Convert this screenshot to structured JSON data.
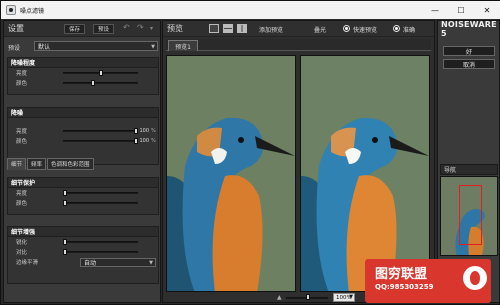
{
  "window": {
    "title": "噪点滤镜",
    "controls": [
      "—",
      "☐",
      "✕"
    ]
  },
  "left": {
    "header": "设置",
    "save": "保存",
    "preset_btn": "预设",
    "preset_label": "预设",
    "preset_value": "默认",
    "sections": [
      {
        "title": "降噪程度",
        "rows": [
          {
            "label": "亮度",
            "pos": 0.5
          },
          {
            "label": "颜色",
            "pos": 0.4
          }
        ]
      },
      {
        "title": "降噪",
        "rows": [
          {
            "label": "亮度",
            "value": "100",
            "unit": "%",
            "pos": 1.0
          },
          {
            "label": "颜色",
            "value": "100",
            "unit": "%",
            "pos": 1.0
          }
        ]
      },
      {
        "title": "细节保护",
        "rows": [
          {
            "label": "亮度",
            "pos": 0.0
          },
          {
            "label": "颜色",
            "pos": 0.0
          }
        ]
      },
      {
        "title": "细节增强",
        "rows": [
          {
            "label": "锐化",
            "pos": 0.0
          },
          {
            "label": "对比",
            "pos": 0.0
          }
        ]
      }
    ],
    "tabs": [
      "细节",
      "频率",
      "色调和色彩范围"
    ],
    "edge": {
      "label": "边缘平滑",
      "value": "自动"
    }
  },
  "center": {
    "header": "预览",
    "add_preview": "添加预览",
    "overlay": "叠光",
    "fast": "快速预览",
    "accurate": "准确",
    "tab": "预览1",
    "zoom": "100%"
  },
  "right": {
    "logo": "NOISEWARE 5",
    "ok": "好",
    "cancel": "取消",
    "nav": "导航"
  },
  "watermark": {
    "title": "图穷联盟",
    "qq": "QQ:985303259"
  }
}
